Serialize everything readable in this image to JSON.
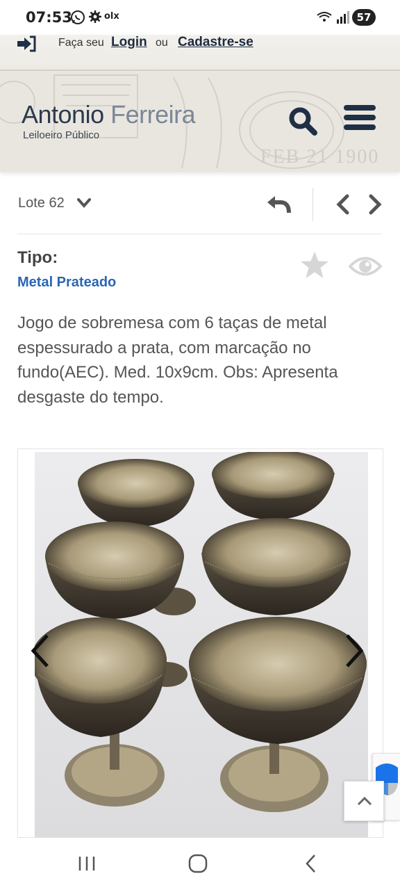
{
  "status_bar": {
    "time": "07:53",
    "app_label": "olx",
    "battery": "57"
  },
  "header": {
    "signin_prefix": "Faça seu",
    "login_link": "Login",
    "connector": "ou",
    "register_link": "Cadastre-se",
    "brand_first": "Antonio",
    "brand_last": "Ferreira",
    "subtitle": "Leiloeiro Público"
  },
  "lot": {
    "label": "Lote 62"
  },
  "item": {
    "tipo_label": "Tipo:",
    "tipo_value": "Metal Prateado",
    "description": "Jogo de sobremesa com 6 taças de metal espessurado a prata, com marcação no fundo(AEC). Med. 10x9cm. Obs: Apresenta desgaste do tempo."
  },
  "colors": {
    "brand_navy": "#1f2f45",
    "link_blue": "#2a66b4",
    "icon_gray": "#d6d6d6"
  },
  "icons": [
    "sign-in-icon",
    "search-icon",
    "menu-icon",
    "reply-icon",
    "chevron-left-icon",
    "chevron-right-icon",
    "star-icon",
    "eye-icon",
    "arrow-up-icon"
  ]
}
